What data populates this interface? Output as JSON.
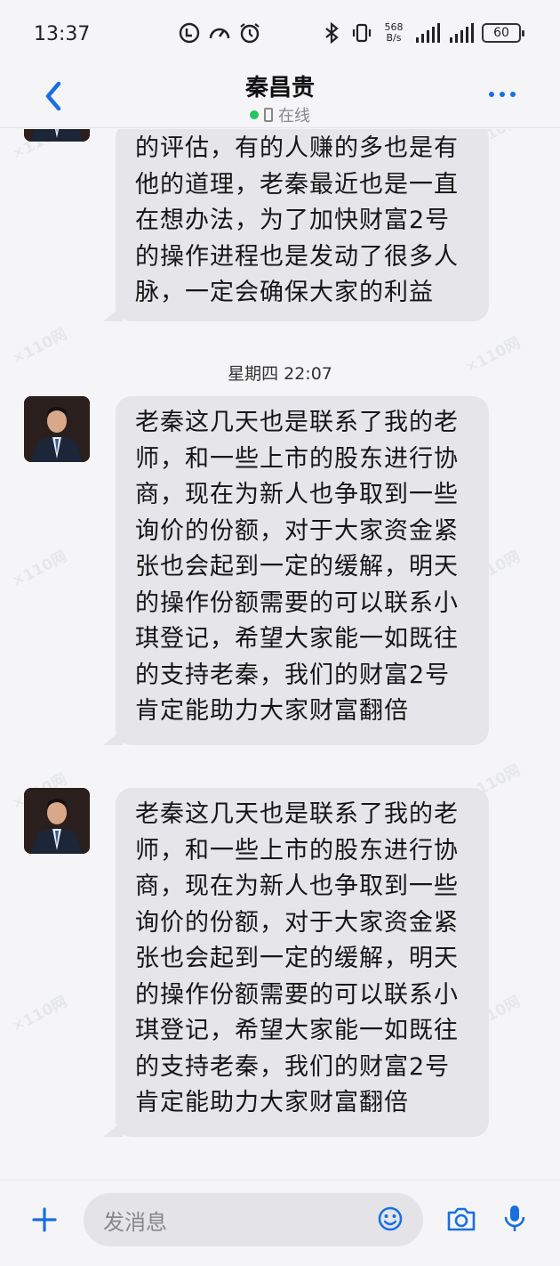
{
  "status_bar": {
    "time": "13:37",
    "net_speed_value": "568",
    "net_speed_unit": "B/s",
    "battery": "60"
  },
  "header": {
    "contact_name": "秦昌贵",
    "presence_label": "在线"
  },
  "messages": [
    {
      "text": "的评估，有的人赚的多也是有他的道理，老秦最近也是一直在想办法，为了加快财富2号的操作进程也是发动了很多人脉，一定会确保大家的利益"
    },
    {
      "text": "老秦这几天也是联系了我的老师，和一些上市的股东进行协商，现在为新人也争取到一些询价的份额，对于大家资金紧张也会起到一定的缓解，明天的操作份额需要的可以联系小琪登记，希望大家能一如既往的支持老秦，我们的财富2号肯定能助力大家财富翻倍"
    },
    {
      "text": "老秦这几天也是联系了我的老师，和一些上市的股东进行协商，现在为新人也争取到一些询价的份额，对于大家资金紧张也会起到一定的缓解，明天的操作份额需要的可以联系小琪登记，希望大家能一如既往的支持老秦，我们的财富2号肯定能助力大家财富翻倍"
    }
  ],
  "timestamp": "星期四 22:07",
  "input": {
    "placeholder": "发消息"
  },
  "colors": {
    "bubble": "#e6e6ea",
    "accent": "#1a6fe0",
    "online": "#22c55e",
    "background": "#f5f5f7"
  }
}
